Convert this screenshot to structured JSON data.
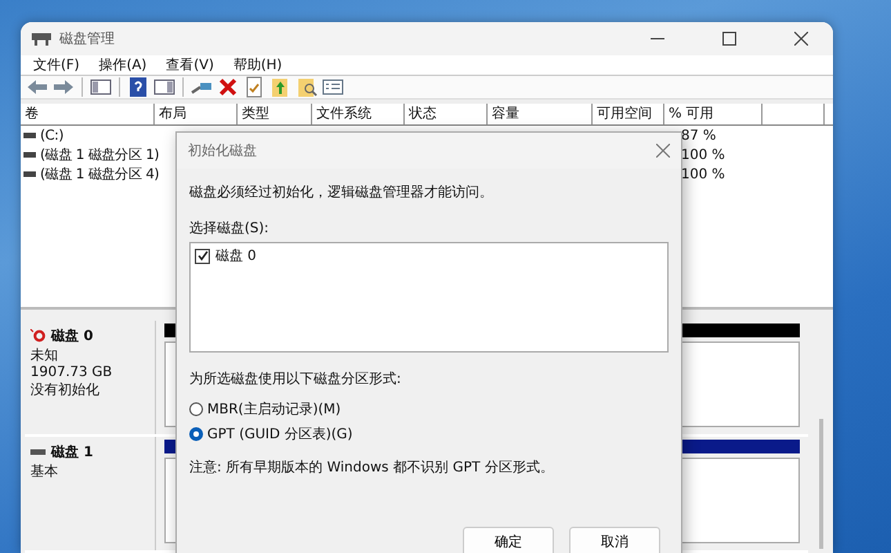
{
  "window": {
    "title": "磁盘管理"
  },
  "menu": [
    {
      "label": "文件(F)"
    },
    {
      "label": "操作(A)"
    },
    {
      "label": "查看(V)"
    },
    {
      "label": "帮助(H)"
    }
  ],
  "volume_table": {
    "columns": [
      "卷",
      "布局",
      "类型",
      "文件系统",
      "状态",
      "容量",
      "可用空间",
      "% 可用"
    ],
    "rows": [
      {
        "volume": "(C:)",
        "percent_free": "87 %"
      },
      {
        "volume": "(磁盘 1 磁盘分区 1)",
        "percent_free": "100 %"
      },
      {
        "volume": "(磁盘 1 磁盘分区 4)",
        "percent_free": "100 %"
      }
    ]
  },
  "disks": [
    {
      "kind": "unknown",
      "name": "磁盘 0",
      "type": "未知",
      "size": "1907.73 GB",
      "status": "没有初始化"
    },
    {
      "kind": "basic",
      "name": "磁盘 1",
      "type": "基本"
    }
  ],
  "dialog": {
    "title": "初始化磁盘",
    "message": "磁盘必须经过初始化，逻辑磁盘管理器才能访问。",
    "select_label": "选择磁盘(S):",
    "disks": [
      {
        "label": "磁盘 0",
        "checked": true
      }
    ],
    "partition_label": "为所选磁盘使用以下磁盘分区形式:",
    "styles": [
      {
        "label": "MBR(主启动记录)(M)",
        "selected": false
      },
      {
        "label": "GPT (GUID 分区表)(G)",
        "selected": true
      }
    ],
    "note": "注意: 所有早期版本的 Windows 都不识别 GPT 分区形式。",
    "buttons": [
      "确定",
      "取消"
    ]
  }
}
